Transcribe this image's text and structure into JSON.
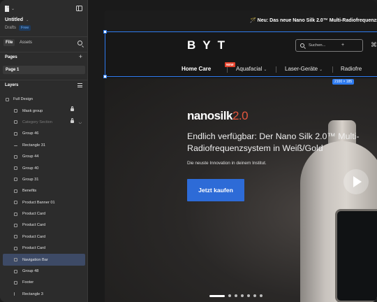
{
  "app": {
    "file_name": "Untitled",
    "file_location": "Drafts",
    "plan_badge": "Free"
  },
  "panel_tabs": {
    "file": "File",
    "assets": "Assets"
  },
  "pages": {
    "title": "Pages",
    "current": "Page 1"
  },
  "layers": {
    "title": "Layers",
    "items": [
      {
        "name": "Full Design"
      },
      {
        "name": "Mask group"
      },
      {
        "name": "Category Section"
      },
      {
        "name": "Group 46"
      },
      {
        "name": "Rectangle 31"
      },
      {
        "name": "Group 44"
      },
      {
        "name": "Group 40"
      },
      {
        "name": "Group 31"
      },
      {
        "name": "Benefits"
      },
      {
        "name": "Product Banner 01"
      },
      {
        "name": "Product Card"
      },
      {
        "name": "Product Card"
      },
      {
        "name": "Product Card"
      },
      {
        "name": "Product Card"
      },
      {
        "name": "Navigation Bar"
      },
      {
        "name": "Group 48"
      },
      {
        "name": "Footer"
      },
      {
        "name": "Rectangle 3"
      }
    ]
  },
  "site": {
    "announcement": "🪄 Neu: Das neue Nano Silk 2.0™ Multi-Radiofrequenzs",
    "brand": "BYT",
    "search_placeholder": "Suchen...",
    "search_plus": "+",
    "nav": [
      {
        "label": "Home Care"
      },
      {
        "label": "Aquafacial",
        "chevron": "⌄"
      },
      {
        "label": "Laser-Geräte",
        "chevron": "⌄"
      },
      {
        "label": "Radiofre"
      }
    ],
    "new_badge": "NEW",
    "hero": {
      "product_name": "nanosilk",
      "product_version": "2.0",
      "headline": "Endlich verfügbar: Der Nano Silk 2.0™ Multi-Radiofrequenzsystem in Weiß/Gold",
      "subline": "Die neuste Innovation in deinem Institut.",
      "cta": "Jetzt kaufen"
    }
  },
  "selection": {
    "dimensions": "2100 × 185"
  },
  "colors": {
    "accent": "#2e7bf0",
    "cta": "#2d6bd7",
    "brand_red": "#e4563e",
    "panel": "#2c2c2c"
  }
}
